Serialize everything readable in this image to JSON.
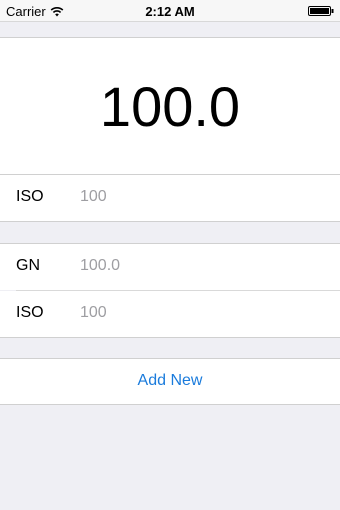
{
  "status_bar": {
    "carrier": "Carrier",
    "time": "2:12 AM",
    "wifi_icon": "wifi-icon",
    "battery_icon": "battery-icon"
  },
  "result": {
    "value": "100.0"
  },
  "result_iso_row": {
    "label": "ISO",
    "value": "100"
  },
  "entry_rows": [
    {
      "label": "GN",
      "value": "100.0"
    },
    {
      "label": "ISO",
      "value": "100"
    }
  ],
  "add_button": {
    "label": "Add New"
  },
  "colors": {
    "accent": "#1a7bdc",
    "background": "#efeff4",
    "placeholder": "#9e9ea2"
  }
}
